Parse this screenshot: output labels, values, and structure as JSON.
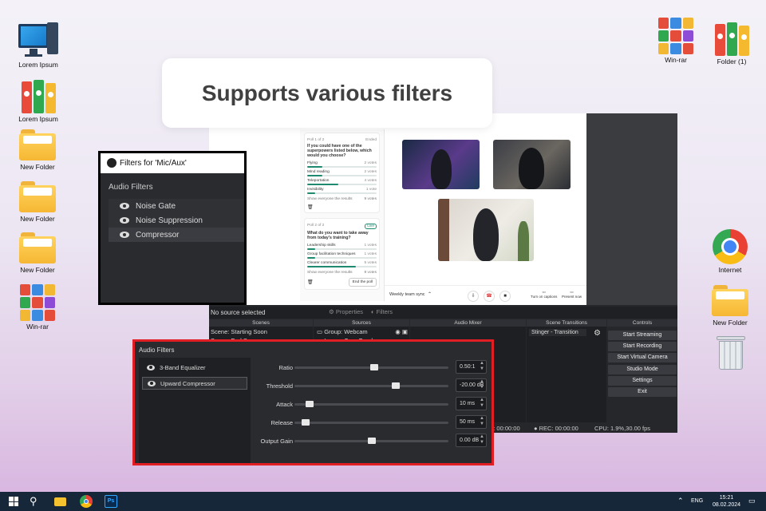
{
  "banner": {
    "text": "Supports various filters"
  },
  "desktop": {
    "left_icons": [
      {
        "label": "Lorem Ipsum",
        "type": "pc"
      },
      {
        "label": "Lorem Ipsum",
        "type": "binders"
      },
      {
        "label": "New Folder",
        "type": "folder"
      },
      {
        "label": "New Folder",
        "type": "folder"
      },
      {
        "label": "New Folder",
        "type": "folder"
      },
      {
        "label": "Win-rar",
        "type": "winrar"
      }
    ],
    "right_icons": [
      {
        "label": "Win-rar"
      },
      {
        "label": "Folder (1)"
      },
      {
        "label": "Internet"
      },
      {
        "label": "New Folder"
      },
      {
        "label": "Recycle Bin"
      }
    ]
  },
  "preview": {
    "poll1": {
      "tag": "Poll 1 of 2",
      "status": "Ended",
      "question": "If you could have one of the superpowers listed below, which would you choose?",
      "options": [
        {
          "label": "Flying",
          "votes": "2 votes",
          "pct": 0.22
        },
        {
          "label": "Mind reading",
          "votes": "2 votes",
          "pct": 0.22
        },
        {
          "label": "Teleportation",
          "votes": "4 votes",
          "pct": 0.45
        },
        {
          "label": "Invisibility",
          "votes": "1 vote",
          "pct": 0.11
        }
      ],
      "foot_left": "Show everyone the results",
      "foot_right": "9 votes"
    },
    "poll2": {
      "tag": "Poll 2 of 2",
      "status": "Live",
      "question": "What do you want to take away from today's training?",
      "options": [
        {
          "label": "Leadership skills",
          "votes": "1 votes",
          "pct": 0.12
        },
        {
          "label": "Group facilitation techniques",
          "votes": "1 votes",
          "pct": 0.12
        },
        {
          "label": "Clearer communication",
          "votes": "5 votes",
          "pct": 0.7
        }
      ],
      "foot_left": "Show everyone the results",
      "foot_right": "9 votes",
      "end_button": "End the poll"
    },
    "meeting_title": "Weekly team sync",
    "captions": "Turn on captions",
    "present": "Present now"
  },
  "obs": {
    "no_source": "No source selected",
    "properties": "Properties",
    "filters": "Filters",
    "docks": {
      "scenes": "Scenes",
      "sources": "Sources",
      "audio_mixer": "Audio Mixer",
      "scene_transitions": "Scene Transitions",
      "controls": "Controls"
    },
    "scenes": [
      "Scene: Starting Soon",
      "Scene: End Screen"
    ],
    "sources": [
      "Group: Webcam",
      "Image: Cam Overlay"
    ],
    "transition": "Stinger - Transition",
    "controls": [
      "Start Streaming",
      "Start Recording",
      "Start Virtual Camera",
      "Studio Mode",
      "Settings",
      "Exit"
    ],
    "status": {
      "live": "LIVE: 00:00:00",
      "rec": "REC: 00:00:00",
      "cpu": "CPU: 1.9%,30.00 fps"
    }
  },
  "filters_small": {
    "title": "Filters for 'Mic/Aux'",
    "section": "Audio Filters",
    "items": [
      "Noise Gate",
      "Noise Suppression",
      "Compressor"
    ]
  },
  "filters_big": {
    "title": "Audio Filters",
    "items": [
      "3-Band Equalizer",
      "Upward Compressor"
    ],
    "params": [
      {
        "label": "Ratio",
        "value": "0.50:1",
        "level": 0.52
      },
      {
        "label": "Threshold",
        "value": "-20.00 dB",
        "level": 0.66
      },
      {
        "label": "Attack",
        "value": "10 ms",
        "level": 0.1
      },
      {
        "label": "Release",
        "value": "50 ms",
        "level": 0.07
      },
      {
        "label": "Output Gain",
        "value": "0.00 dB",
        "level": 0.5
      }
    ]
  },
  "taskbar": {
    "lang": "ENG",
    "time": "15:21",
    "date": "08.02.2024"
  }
}
